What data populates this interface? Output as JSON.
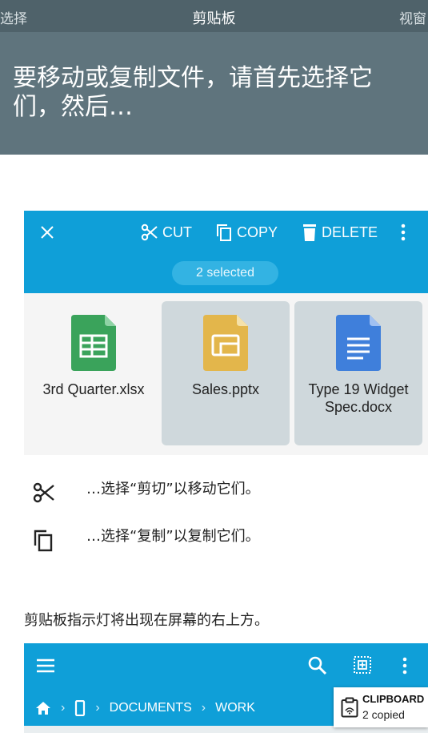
{
  "header": {
    "nav_left": "选择",
    "nav_title": "剪贴板",
    "nav_right": "视窗",
    "headline": "要移动或复制文件，请首先选择它们，然后…"
  },
  "action_bar": {
    "cut_label": "CUT",
    "copy_label": "COPY",
    "delete_label": "DELETE",
    "selected_count": "2 selected",
    "close_icon": "close-icon",
    "more_icon": "more-vert-icon"
  },
  "files": [
    {
      "name": "3rd Quarter.xlsx",
      "selected": false,
      "icon": "sheets-file-icon",
      "color": "#3aa35b"
    },
    {
      "name": "Sales.pptx",
      "selected": true,
      "icon": "slides-file-icon",
      "color": "#e3b64b"
    },
    {
      "name": "Type 19 Widget Spec.docx",
      "selected": true,
      "icon": "docs-file-icon",
      "color": "#3f7fdb"
    }
  ],
  "instructions": {
    "cut_text": "…选择“剪切”以移动它们。",
    "copy_text": "…选择“复制”以复制它们。"
  },
  "note": "剪贴板指示灯将出现在屏幕的右上方。",
  "file_manager": {
    "breadcrumb": [
      "DOCUMENTS",
      "WORK"
    ],
    "icons": [
      "menu-icon",
      "search-icon",
      "select-all-icon",
      "more-vert-icon",
      "home-icon",
      "device-icon"
    ]
  },
  "clipboard_indicator": {
    "title": "CLIPBOARD",
    "subtitle": "2 copied"
  },
  "colors": {
    "header_bg": "#5f747d",
    "accent": "#0f9fd8",
    "selection_bg": "#cfd8dc"
  }
}
